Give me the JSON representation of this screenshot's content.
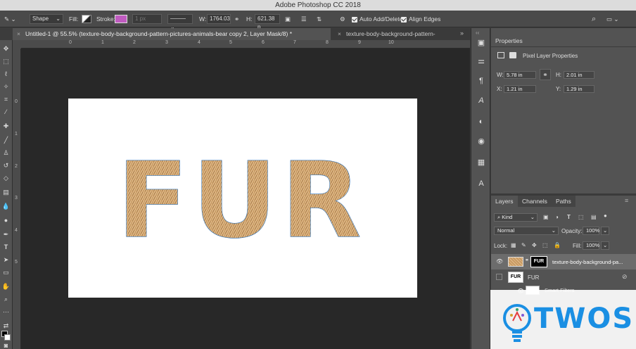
{
  "app": {
    "title": "Adobe Photoshop CC 2018"
  },
  "options": {
    "mode": "Shape",
    "fill_label": "Fill:",
    "stroke_label": "Stroke:",
    "stroke_width": "1 px",
    "width_label": "W:",
    "width_value": "1764.03",
    "height_label": "H:",
    "height_value": "621.38 p",
    "auto_add_delete": "Auto Add/Delete",
    "align_edges": "Align Edges"
  },
  "tabs": [
    {
      "label": "Untitled-1 @ 55.5% (texture-body-background-pattern-pictures-animals-bear copy 2, Layer Mask/8) *"
    },
    {
      "label": "texture-body-background-pattern-"
    }
  ],
  "ruler_top": [
    "0",
    "1",
    "2",
    "3",
    "4",
    "5",
    "6",
    "7",
    "8",
    "9",
    "10"
  ],
  "ruler_left": [
    "0",
    "1",
    "2",
    "3",
    "4",
    "5"
  ],
  "canvas": {
    "text": "FUR"
  },
  "properties": {
    "tab": "Properties",
    "heading": "Pixel Layer Properties",
    "w_label": "W:",
    "w_value": "5.78 in",
    "h_label": "H:",
    "h_value": "2.01 in",
    "x_label": "X:",
    "x_value": "1.21 in",
    "y_label": "Y:",
    "y_value": "1.29 in"
  },
  "layers_panel": {
    "tabs": [
      "Layers",
      "Channels",
      "Paths"
    ],
    "kind": "Kind",
    "blend_mode": "Normal",
    "opacity_label": "Opacity:",
    "opacity_value": "100%",
    "lock_label": "Lock:",
    "fill_label": "Fill:",
    "fill_value": "100%",
    "layers": [
      {
        "name": "texture-body-background-pa...",
        "mask_label": "FUR"
      },
      {
        "name": "FUR",
        "thumb_label": "FUR"
      },
      {
        "name": "Smart Filters"
      }
    ]
  },
  "watermark": {
    "text": "TWOS"
  },
  "colors": {
    "accent": "#1a8fe3",
    "fur": "#c89a62",
    "path_outline": "#2b6cb0"
  }
}
